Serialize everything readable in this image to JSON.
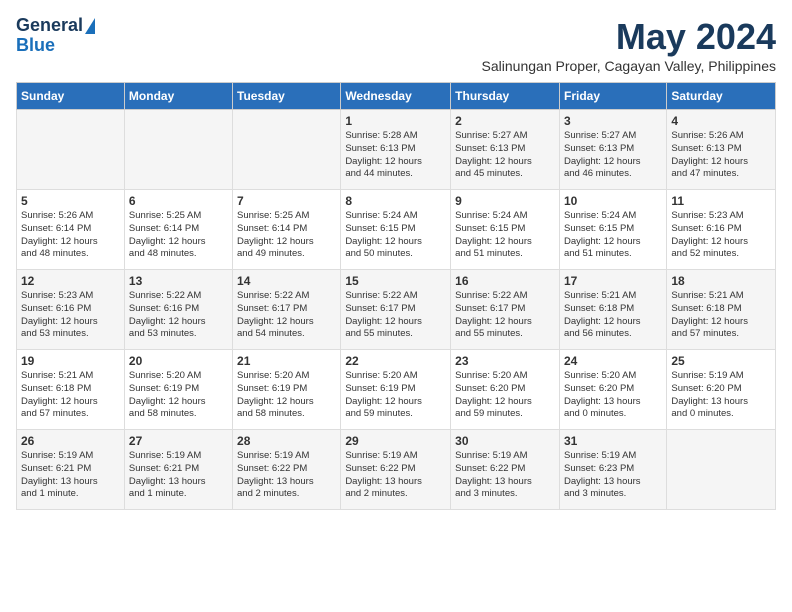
{
  "logo": {
    "line1": "General",
    "line2": "Blue"
  },
  "title": "May 2024",
  "subtitle": "Salinungan Proper, Cagayan Valley, Philippines",
  "weekdays": [
    "Sunday",
    "Monday",
    "Tuesday",
    "Wednesday",
    "Thursday",
    "Friday",
    "Saturday"
  ],
  "weeks": [
    [
      {
        "day": "",
        "lines": []
      },
      {
        "day": "",
        "lines": []
      },
      {
        "day": "",
        "lines": []
      },
      {
        "day": "1",
        "lines": [
          "Sunrise: 5:28 AM",
          "Sunset: 6:13 PM",
          "Daylight: 12 hours",
          "and 44 minutes."
        ]
      },
      {
        "day": "2",
        "lines": [
          "Sunrise: 5:27 AM",
          "Sunset: 6:13 PM",
          "Daylight: 12 hours",
          "and 45 minutes."
        ]
      },
      {
        "day": "3",
        "lines": [
          "Sunrise: 5:27 AM",
          "Sunset: 6:13 PM",
          "Daylight: 12 hours",
          "and 46 minutes."
        ]
      },
      {
        "day": "4",
        "lines": [
          "Sunrise: 5:26 AM",
          "Sunset: 6:13 PM",
          "Daylight: 12 hours",
          "and 47 minutes."
        ]
      }
    ],
    [
      {
        "day": "5",
        "lines": [
          "Sunrise: 5:26 AM",
          "Sunset: 6:14 PM",
          "Daylight: 12 hours",
          "and 48 minutes."
        ]
      },
      {
        "day": "6",
        "lines": [
          "Sunrise: 5:25 AM",
          "Sunset: 6:14 PM",
          "Daylight: 12 hours",
          "and 48 minutes."
        ]
      },
      {
        "day": "7",
        "lines": [
          "Sunrise: 5:25 AM",
          "Sunset: 6:14 PM",
          "Daylight: 12 hours",
          "and 49 minutes."
        ]
      },
      {
        "day": "8",
        "lines": [
          "Sunrise: 5:24 AM",
          "Sunset: 6:15 PM",
          "Daylight: 12 hours",
          "and 50 minutes."
        ]
      },
      {
        "day": "9",
        "lines": [
          "Sunrise: 5:24 AM",
          "Sunset: 6:15 PM",
          "Daylight: 12 hours",
          "and 51 minutes."
        ]
      },
      {
        "day": "10",
        "lines": [
          "Sunrise: 5:24 AM",
          "Sunset: 6:15 PM",
          "Daylight: 12 hours",
          "and 51 minutes."
        ]
      },
      {
        "day": "11",
        "lines": [
          "Sunrise: 5:23 AM",
          "Sunset: 6:16 PM",
          "Daylight: 12 hours",
          "and 52 minutes."
        ]
      }
    ],
    [
      {
        "day": "12",
        "lines": [
          "Sunrise: 5:23 AM",
          "Sunset: 6:16 PM",
          "Daylight: 12 hours",
          "and 53 minutes."
        ]
      },
      {
        "day": "13",
        "lines": [
          "Sunrise: 5:22 AM",
          "Sunset: 6:16 PM",
          "Daylight: 12 hours",
          "and 53 minutes."
        ]
      },
      {
        "day": "14",
        "lines": [
          "Sunrise: 5:22 AM",
          "Sunset: 6:17 PM",
          "Daylight: 12 hours",
          "and 54 minutes."
        ]
      },
      {
        "day": "15",
        "lines": [
          "Sunrise: 5:22 AM",
          "Sunset: 6:17 PM",
          "Daylight: 12 hours",
          "and 55 minutes."
        ]
      },
      {
        "day": "16",
        "lines": [
          "Sunrise: 5:22 AM",
          "Sunset: 6:17 PM",
          "Daylight: 12 hours",
          "and 55 minutes."
        ]
      },
      {
        "day": "17",
        "lines": [
          "Sunrise: 5:21 AM",
          "Sunset: 6:18 PM",
          "Daylight: 12 hours",
          "and 56 minutes."
        ]
      },
      {
        "day": "18",
        "lines": [
          "Sunrise: 5:21 AM",
          "Sunset: 6:18 PM",
          "Daylight: 12 hours",
          "and 57 minutes."
        ]
      }
    ],
    [
      {
        "day": "19",
        "lines": [
          "Sunrise: 5:21 AM",
          "Sunset: 6:18 PM",
          "Daylight: 12 hours",
          "and 57 minutes."
        ]
      },
      {
        "day": "20",
        "lines": [
          "Sunrise: 5:20 AM",
          "Sunset: 6:19 PM",
          "Daylight: 12 hours",
          "and 58 minutes."
        ]
      },
      {
        "day": "21",
        "lines": [
          "Sunrise: 5:20 AM",
          "Sunset: 6:19 PM",
          "Daylight: 12 hours",
          "and 58 minutes."
        ]
      },
      {
        "day": "22",
        "lines": [
          "Sunrise: 5:20 AM",
          "Sunset: 6:19 PM",
          "Daylight: 12 hours",
          "and 59 minutes."
        ]
      },
      {
        "day": "23",
        "lines": [
          "Sunrise: 5:20 AM",
          "Sunset: 6:20 PM",
          "Daylight: 12 hours",
          "and 59 minutes."
        ]
      },
      {
        "day": "24",
        "lines": [
          "Sunrise: 5:20 AM",
          "Sunset: 6:20 PM",
          "Daylight: 13 hours",
          "and 0 minutes."
        ]
      },
      {
        "day": "25",
        "lines": [
          "Sunrise: 5:19 AM",
          "Sunset: 6:20 PM",
          "Daylight: 13 hours",
          "and 0 minutes."
        ]
      }
    ],
    [
      {
        "day": "26",
        "lines": [
          "Sunrise: 5:19 AM",
          "Sunset: 6:21 PM",
          "Daylight: 13 hours",
          "and 1 minute."
        ]
      },
      {
        "day": "27",
        "lines": [
          "Sunrise: 5:19 AM",
          "Sunset: 6:21 PM",
          "Daylight: 13 hours",
          "and 1 minute."
        ]
      },
      {
        "day": "28",
        "lines": [
          "Sunrise: 5:19 AM",
          "Sunset: 6:22 PM",
          "Daylight: 13 hours",
          "and 2 minutes."
        ]
      },
      {
        "day": "29",
        "lines": [
          "Sunrise: 5:19 AM",
          "Sunset: 6:22 PM",
          "Daylight: 13 hours",
          "and 2 minutes."
        ]
      },
      {
        "day": "30",
        "lines": [
          "Sunrise: 5:19 AM",
          "Sunset: 6:22 PM",
          "Daylight: 13 hours",
          "and 3 minutes."
        ]
      },
      {
        "day": "31",
        "lines": [
          "Sunrise: 5:19 AM",
          "Sunset: 6:23 PM",
          "Daylight: 13 hours",
          "and 3 minutes."
        ]
      },
      {
        "day": "",
        "lines": []
      }
    ]
  ]
}
